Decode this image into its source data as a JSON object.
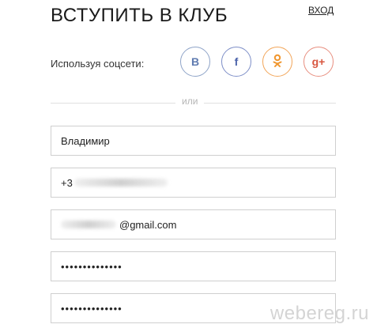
{
  "header": {
    "title": "ВСТУПИТЬ В КЛУБ",
    "login_link": "ВХОД"
  },
  "social": {
    "label": "Используя соцсети:",
    "buttons": [
      {
        "name": "vk",
        "glyph": "В",
        "color": "#5f7bb0"
      },
      {
        "name": "facebook",
        "glyph": "f",
        "color": "#4b63aa"
      },
      {
        "name": "odnoklassniki",
        "glyph": "ok",
        "color": "#f0962e"
      },
      {
        "name": "google-plus",
        "glyph": "g+",
        "color": "#d8563f"
      }
    ]
  },
  "divider": {
    "text": "или"
  },
  "form": {
    "name_value": "Владимир",
    "phone_prefix": "+3",
    "email_suffix": "@gmail.com",
    "password_value": "••••••••••••••",
    "password_confirm_value": "••••••••••••••"
  },
  "watermark": "webereg.ru"
}
